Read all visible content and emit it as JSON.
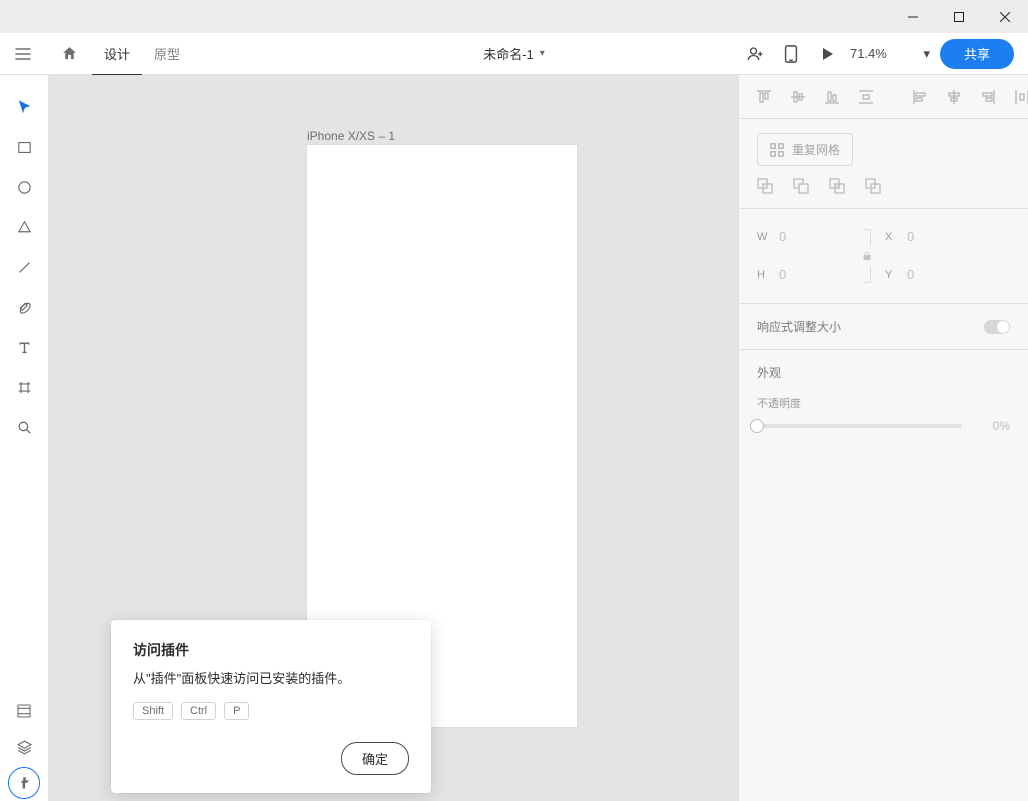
{
  "titlebar": {},
  "topnav": {
    "tab_design": "设计",
    "tab_prototype": "原型",
    "doc_title": "未命名-1",
    "zoom": "71.4%",
    "share": "共享"
  },
  "canvas": {
    "artboard_label": "iPhone X/XS – 1"
  },
  "popover": {
    "title": "访问插件",
    "body": "从\"插件\"面板快速访问已安装的插件。",
    "key1": "Shift",
    "key2": "Ctrl",
    "key3": "P",
    "ok": "确定"
  },
  "inspector": {
    "repeat_grid": "重复网格",
    "geom": {
      "w_label": "W",
      "w": "0",
      "h_label": "H",
      "h": "0",
      "x_label": "X",
      "x": "0",
      "y_label": "Y",
      "y": "0"
    },
    "responsive": "响应式调整大小",
    "appearance": "外观",
    "opacity_label": "不透明度",
    "opacity_value": "0%"
  }
}
